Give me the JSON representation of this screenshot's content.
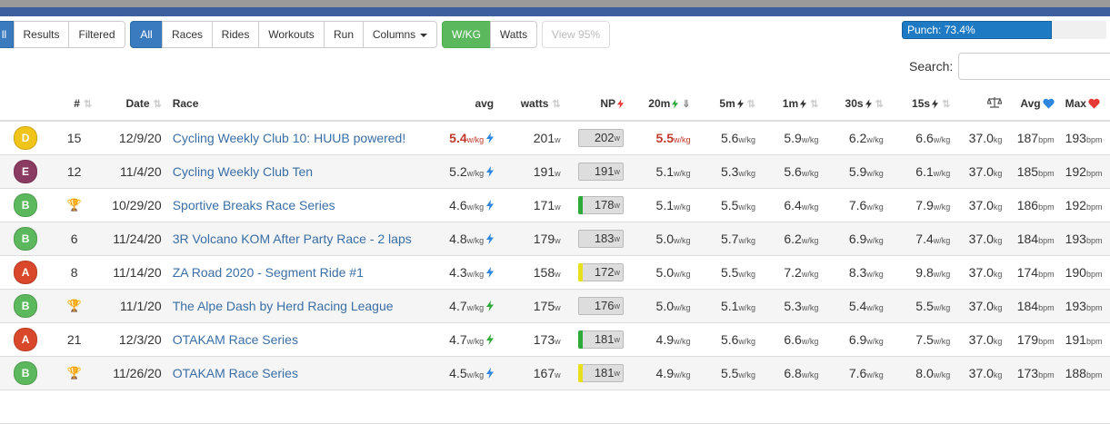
{
  "toolbar": {
    "group1": [
      "ll",
      "Results",
      "Filtered"
    ],
    "group2": [
      "All",
      "Races",
      "Rides",
      "Workouts",
      "Run"
    ],
    "columns_label": "Columns",
    "group3": [
      "W/KG",
      "Watts"
    ],
    "view95_label": "View 95%"
  },
  "punch": {
    "label": "Punch: 73.4%",
    "value_percent": 73.4
  },
  "search": {
    "label": "Search:",
    "value": ""
  },
  "colors": {
    "accent_blue": "#3a7bbf",
    "green": "#5cb85c",
    "link": "#3a6ea5",
    "cat_A": "#d9482b",
    "cat_B": "#5cb85c",
    "cat_D": "#f0c419",
    "cat_E": "#8b3a62"
  },
  "table": {
    "headers": {
      "num": "#",
      "date": "Date",
      "race": "Race",
      "avg": "avg",
      "watts": "watts",
      "np": "NP",
      "m20": "20m",
      "m5": "5m",
      "m1": "1m",
      "s30": "30s",
      "s15": "15s",
      "weight": "",
      "avg_hr": "Avg",
      "max_hr": "Max"
    },
    "rows": [
      {
        "cat": "D",
        "num": "15",
        "trophy": false,
        "date": "12/9/20",
        "race": "Cycling Weekly Club 10: HUUB powered!",
        "avg": "5.4",
        "avg_unit": "w/kg",
        "avg_red": true,
        "avg_bolt": "blue",
        "watts": "201",
        "watts_unit": "w",
        "np": "202",
        "np_unit": "w",
        "np_mark": "",
        "m20": "5.5",
        "m20_red": true,
        "m5": "5.6",
        "m1": "5.9",
        "s30": "6.2",
        "s15": "6.6",
        "wkg_unit": "w/kg",
        "weight": "37.0",
        "weight_unit": "kg",
        "avg_hr": "187",
        "max_hr": "193",
        "bpm_unit": "bpm"
      },
      {
        "cat": "E",
        "num": "12",
        "trophy": false,
        "date": "11/4/20",
        "race": "Cycling Weekly Club Ten",
        "avg": "5.2",
        "avg_unit": "w/kg",
        "avg_red": false,
        "avg_bolt": "blue",
        "watts": "191",
        "watts_unit": "w",
        "np": "191",
        "np_unit": "w",
        "np_mark": "",
        "m20": "5.1",
        "m20_red": false,
        "m5": "5.3",
        "m1": "5.6",
        "s30": "5.9",
        "s15": "6.1",
        "wkg_unit": "w/kg",
        "weight": "37.0",
        "weight_unit": "kg",
        "avg_hr": "185",
        "max_hr": "192",
        "bpm_unit": "bpm"
      },
      {
        "cat": "B",
        "num": "",
        "trophy": true,
        "date": "10/29/20",
        "race": "Sportive Breaks Race Series",
        "avg": "4.6",
        "avg_unit": "w/kg",
        "avg_red": false,
        "avg_bolt": "blue",
        "watts": "171",
        "watts_unit": "w",
        "np": "178",
        "np_unit": "w",
        "np_mark": "#2eaa3a",
        "m20": "5.1",
        "m20_red": false,
        "m5": "5.5",
        "m1": "6.4",
        "s30": "7.6",
        "s15": "7.9",
        "wkg_unit": "w/kg",
        "weight": "37.0",
        "weight_unit": "kg",
        "avg_hr": "186",
        "max_hr": "192",
        "bpm_unit": "bpm"
      },
      {
        "cat": "B",
        "num": "6",
        "trophy": false,
        "date": "11/24/20",
        "race": "3R Volcano KOM After Party Race - 2 laps",
        "avg": "4.8",
        "avg_unit": "w/kg",
        "avg_red": false,
        "avg_bolt": "blue",
        "watts": "179",
        "watts_unit": "w",
        "np": "183",
        "np_unit": "w",
        "np_mark": "",
        "m20": "5.0",
        "m20_red": false,
        "m5": "5.7",
        "m1": "6.2",
        "s30": "6.9",
        "s15": "7.4",
        "wkg_unit": "w/kg",
        "weight": "37.0",
        "weight_unit": "kg",
        "avg_hr": "184",
        "max_hr": "193",
        "bpm_unit": "bpm"
      },
      {
        "cat": "A",
        "num": "8",
        "trophy": false,
        "date": "11/14/20",
        "race": "ZA Road 2020 - Segment Ride #1",
        "avg": "4.3",
        "avg_unit": "w/kg",
        "avg_red": false,
        "avg_bolt": "blue",
        "watts": "158",
        "watts_unit": "w",
        "np": "172",
        "np_unit": "w",
        "np_mark": "#e8e01a",
        "m20": "5.0",
        "m20_red": false,
        "m5": "5.5",
        "m1": "7.2",
        "s30": "8.3",
        "s15": "9.8",
        "wkg_unit": "w/kg",
        "weight": "37.0",
        "weight_unit": "kg",
        "avg_hr": "174",
        "max_hr": "190",
        "bpm_unit": "bpm"
      },
      {
        "cat": "B",
        "num": "",
        "trophy": true,
        "date": "11/1/20",
        "race": "The Alpe Dash by Herd Racing League",
        "avg": "4.7",
        "avg_unit": "w/kg",
        "avg_red": false,
        "avg_bolt": "green",
        "watts": "175",
        "watts_unit": "w",
        "np": "176",
        "np_unit": "w",
        "np_mark": "",
        "m20": "5.0",
        "m20_red": false,
        "m5": "5.1",
        "m1": "5.3",
        "s30": "5.4",
        "s15": "5.5",
        "wkg_unit": "w/kg",
        "weight": "37.0",
        "weight_unit": "kg",
        "avg_hr": "184",
        "max_hr": "193",
        "bpm_unit": "bpm"
      },
      {
        "cat": "A",
        "num": "21",
        "trophy": false,
        "date": "12/3/20",
        "race": "OTAKAM Race Series",
        "avg": "4.7",
        "avg_unit": "w/kg",
        "avg_red": false,
        "avg_bolt": "green",
        "watts": "173",
        "watts_unit": "w",
        "np": "181",
        "np_unit": "w",
        "np_mark": "#2eaa3a",
        "m20": "4.9",
        "m20_red": false,
        "m5": "5.6",
        "m1": "6.6",
        "s30": "6.9",
        "s15": "7.5",
        "wkg_unit": "w/kg",
        "weight": "37.0",
        "weight_unit": "kg",
        "avg_hr": "179",
        "max_hr": "191",
        "bpm_unit": "bpm"
      },
      {
        "cat": "B",
        "num": "",
        "trophy": true,
        "date": "11/26/20",
        "race": "OTAKAM Race Series",
        "avg": "4.5",
        "avg_unit": "w/kg",
        "avg_red": false,
        "avg_bolt": "blue",
        "watts": "167",
        "watts_unit": "w",
        "np": "181",
        "np_unit": "w",
        "np_mark": "#e8e01a",
        "m20": "4.9",
        "m20_red": false,
        "m5": "5.5",
        "m1": "6.8",
        "s30": "7.6",
        "s15": "8.0",
        "wkg_unit": "w/kg",
        "weight": "37.0",
        "weight_unit": "kg",
        "avg_hr": "173",
        "max_hr": "188",
        "bpm_unit": "bpm"
      }
    ]
  }
}
